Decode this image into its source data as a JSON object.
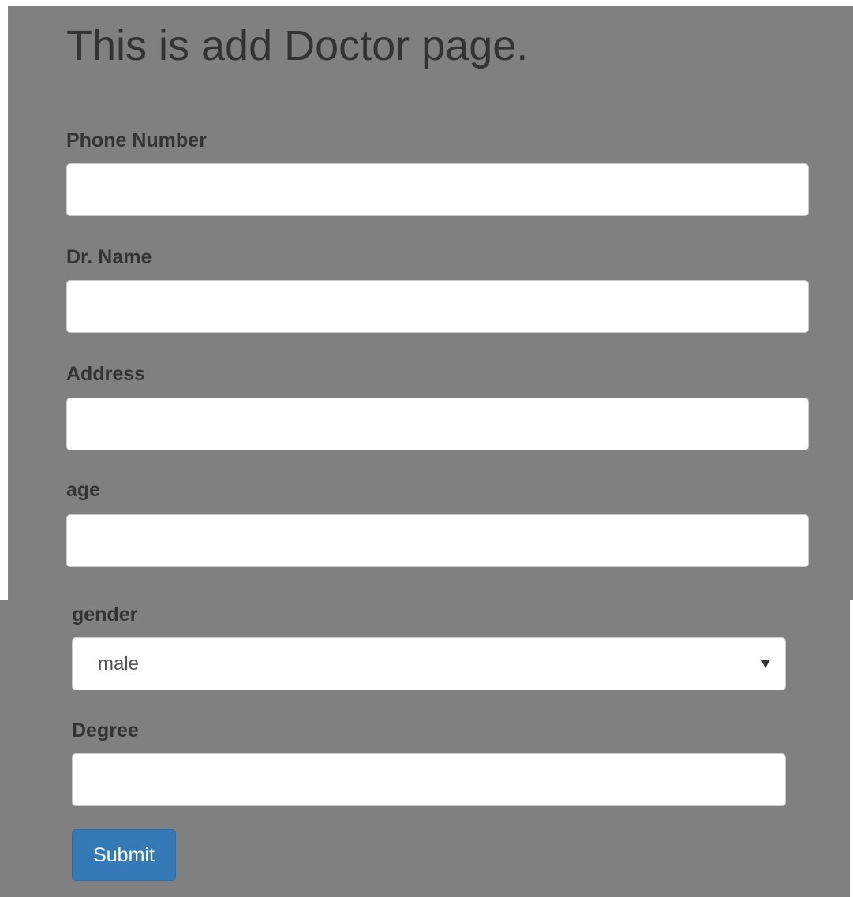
{
  "page": {
    "title": "This is add Doctor page."
  },
  "form": {
    "phone": {
      "label": "Phone Number",
      "value": ""
    },
    "name": {
      "label": "Dr. Name",
      "value": ""
    },
    "address": {
      "label": "Address",
      "value": ""
    },
    "age": {
      "label": "age",
      "value": ""
    },
    "gender": {
      "label": "gender",
      "selected": "male"
    },
    "degree": {
      "label": "Degree",
      "value": ""
    },
    "submit_label": "Submit"
  },
  "colors": {
    "page_background": "#808080",
    "primary_button": "#337ab7",
    "text": "#333333"
  },
  "icons": {
    "select_arrow": "dropdown-triangle"
  }
}
